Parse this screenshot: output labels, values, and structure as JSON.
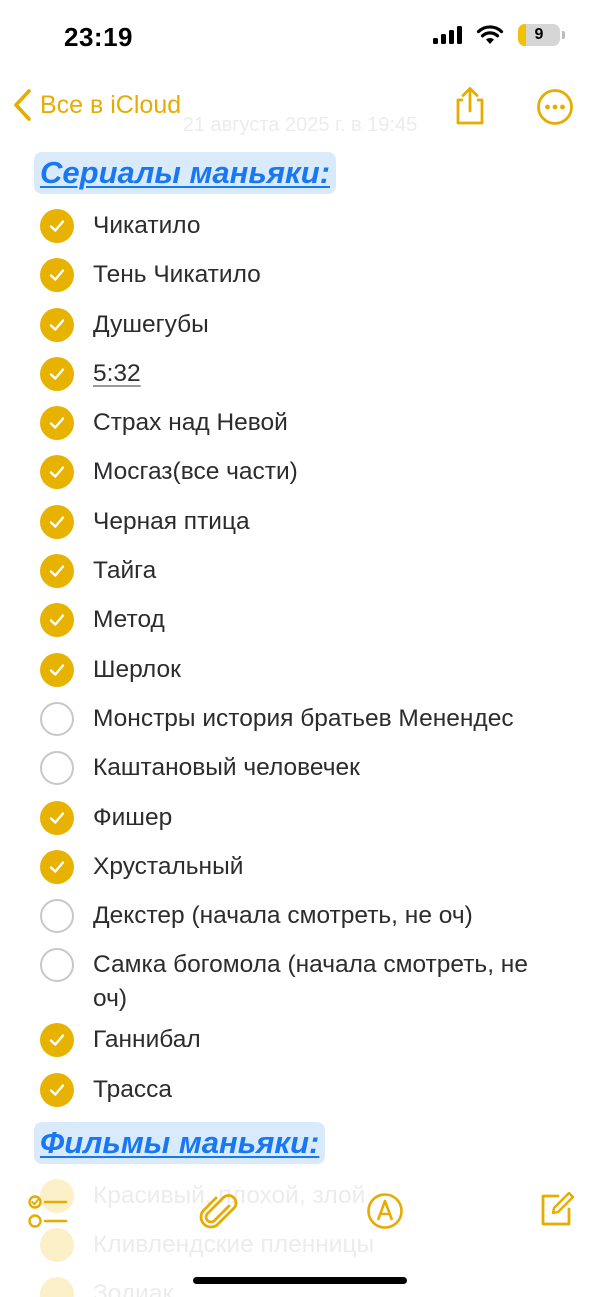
{
  "status_bar": {
    "time": "23:19",
    "battery_level": "9"
  },
  "nav": {
    "back_label": "Все в iCloud",
    "date": "21 августа 2025 г. в 19:45",
    "accent_color": "#e6ac00"
  },
  "note": {
    "heading_1": "Сериалы маньяки:",
    "checklist": [
      {
        "text": "Чикатило",
        "checked": true
      },
      {
        "text": "Тень Чикатило",
        "checked": true
      },
      {
        "text": "Душегубы",
        "checked": true
      },
      {
        "text": "5:32",
        "checked": true
      },
      {
        "text": "Страх над Невой",
        "checked": true
      },
      {
        "text": "Мосгаз(все части)",
        "checked": true
      },
      {
        "text": "Черная птица",
        "checked": true
      },
      {
        "text": "Тайга",
        "checked": true
      },
      {
        "text": "Метод",
        "checked": true
      },
      {
        "text": "Шерлок",
        "checked": true
      },
      {
        "text": "Монстры история братьев Менендес",
        "checked": false
      },
      {
        "text": "Каштановый человечек",
        "checked": false
      },
      {
        "text": "Фишер",
        "checked": true
      },
      {
        "text": "Хрустальный",
        "checked": true
      },
      {
        "text": "Декстер (начала смотреть, не оч)",
        "checked": false
      },
      {
        "text": "Самка богомола (начала смотреть, не оч)",
        "checked": false
      },
      {
        "text": "Ганнибал",
        "checked": true
      },
      {
        "text": "Трасса",
        "checked": true
      }
    ],
    "heading_2": "Фильмы маньяки:",
    "faded_items": [
      "Красивый, плохой, злой",
      "Кливлендские пленницы",
      "Зодиак"
    ]
  },
  "icons": {
    "back": "chevron-left-icon",
    "share": "share-icon",
    "more": "ellipsis-circle-icon",
    "checklist": "checklist-icon",
    "attach": "paperclip-icon",
    "markup": "pen-circle-icon",
    "compose": "compose-icon"
  }
}
